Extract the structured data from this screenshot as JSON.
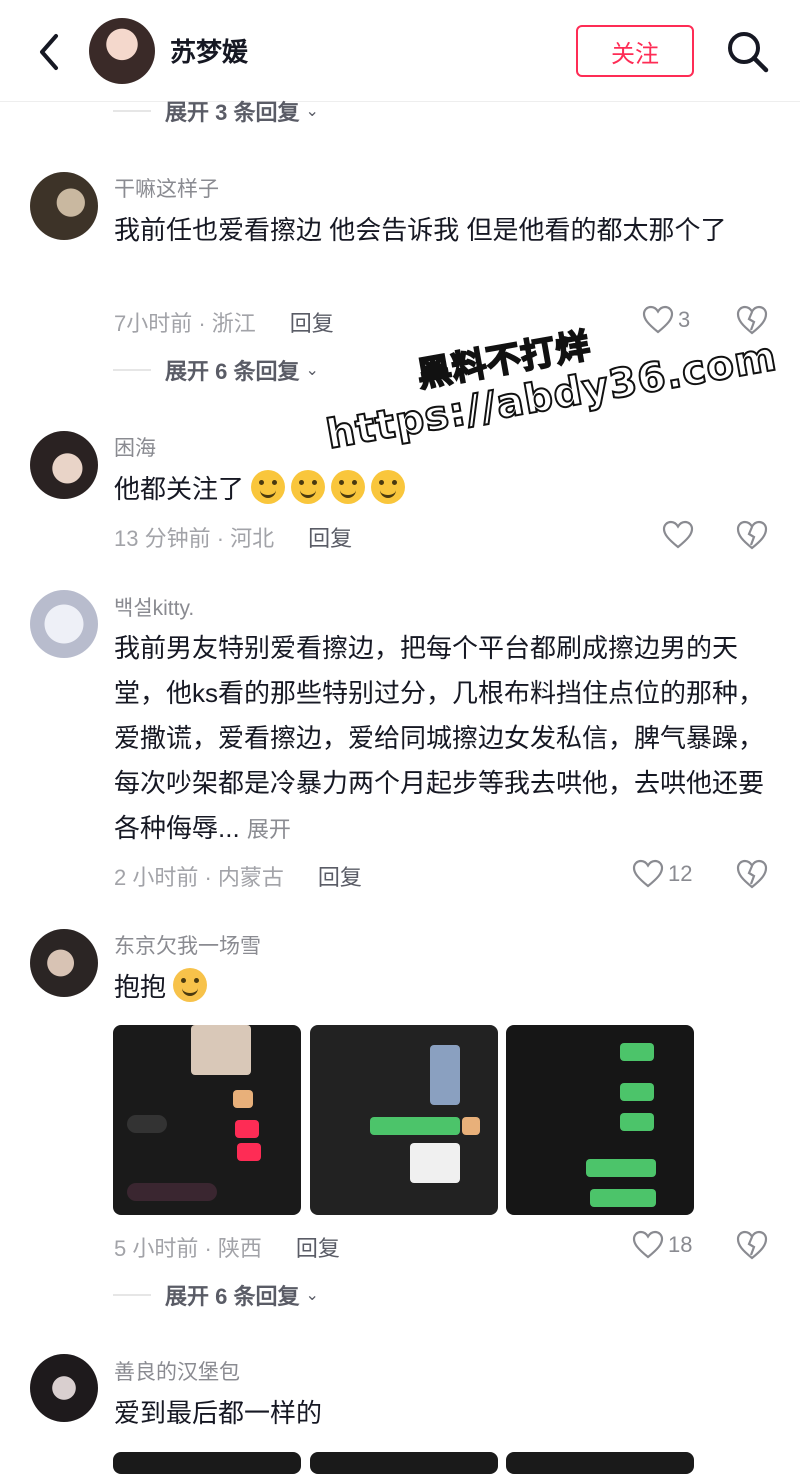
{
  "header": {
    "back_icon": "chevron-left-icon",
    "title": "苏梦媛",
    "follow_label": "关注",
    "search_icon": "search-icon",
    "accent_color": "#fe2c55"
  },
  "watermark": {
    "line1": "黑料不打烊",
    "line2": "https://abdy36.com"
  },
  "expand_rows": [
    {
      "label": "展开 3 条回复"
    },
    {
      "label": "展开 6 条回复"
    },
    {
      "label": "展开 6 条回复"
    }
  ],
  "comments": [
    {
      "username": "干嘛这样子",
      "text": "我前任也爱看擦边 他会告诉我 但是他看的都太那个了",
      "meta": "7小时前 · 浙江",
      "reply_label": "回复",
      "likes": "3"
    },
    {
      "username": "困海",
      "text": "他都关注了",
      "emoji_count": 4,
      "meta": "13 分钟前 · 河北",
      "reply_label": "回复",
      "likes": ""
    },
    {
      "username": "백설kitty.",
      "text": "我前男友特别爱看擦边，把每个平台都刷成擦边男的天堂，他ks看的那些特别过分，几根布料挡住点位的那种，爱撒谎，爱看擦边，爱给同城擦边女发私信，脾气暴躁，每次吵架都是冷暴力两个月起步等我去哄他，去哄他还要各种侮辱...",
      "more_label": "展开",
      "meta": "2 小时前 · 内蒙古",
      "reply_label": "回复",
      "likes": "12"
    },
    {
      "username": "东京欠我一场雪",
      "text": "抱抱",
      "meta": "5 小时前 · 陕西",
      "reply_label": "回复",
      "likes": "18"
    },
    {
      "username": "善良的汉堡包",
      "text": "爱到最后都一样的"
    }
  ]
}
